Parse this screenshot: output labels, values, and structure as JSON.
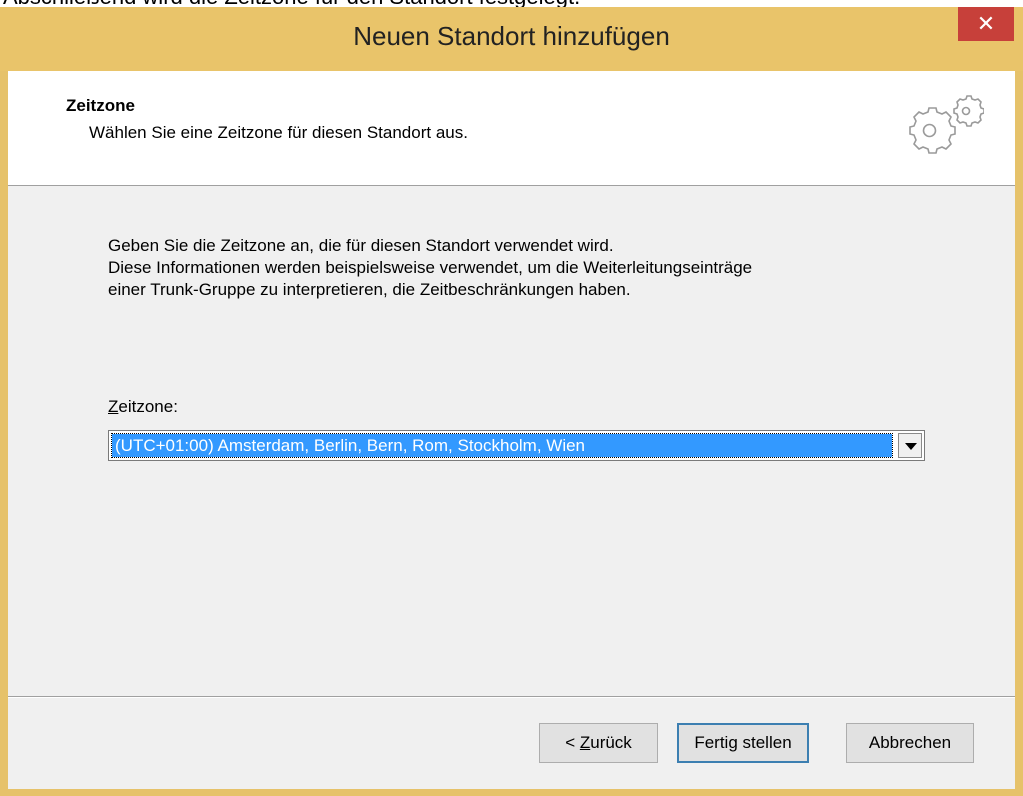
{
  "caption": "Abschließend wird die Zeitzone für den Standort festgelegt.",
  "window": {
    "title": "Neuen Standort hinzufügen",
    "close_glyph": "✕",
    "titlebar_color": "#e9c46a",
    "close_color": "#c7403a"
  },
  "header": {
    "title": "Zeitzone",
    "subtitle": "Wählen Sie eine Zeitzone für diesen Standort aus.",
    "icon": "gears-icon"
  },
  "body": {
    "description_lines": [
      "Geben Sie die Zeitzone an, die für diesen Standort verwendet wird.",
      "Diese Informationen werden beispielsweise verwendet, um die Weiterleitungseinträge",
      "einer Trunk-Gruppe zu interpretieren, die Zeitbeschränkungen haben."
    ],
    "timezone_label_access_key": "Z",
    "timezone_label_rest": "eitzone:",
    "timezone_selected": "(UTC+01:00) Amsterdam, Berlin, Bern, Rom, Stockholm, Wien"
  },
  "buttons": {
    "back_prefix": "< ",
    "back_access_key": "Z",
    "back_rest": "urück",
    "finish": "Fertig stellen",
    "cancel": "Abbrechen"
  }
}
